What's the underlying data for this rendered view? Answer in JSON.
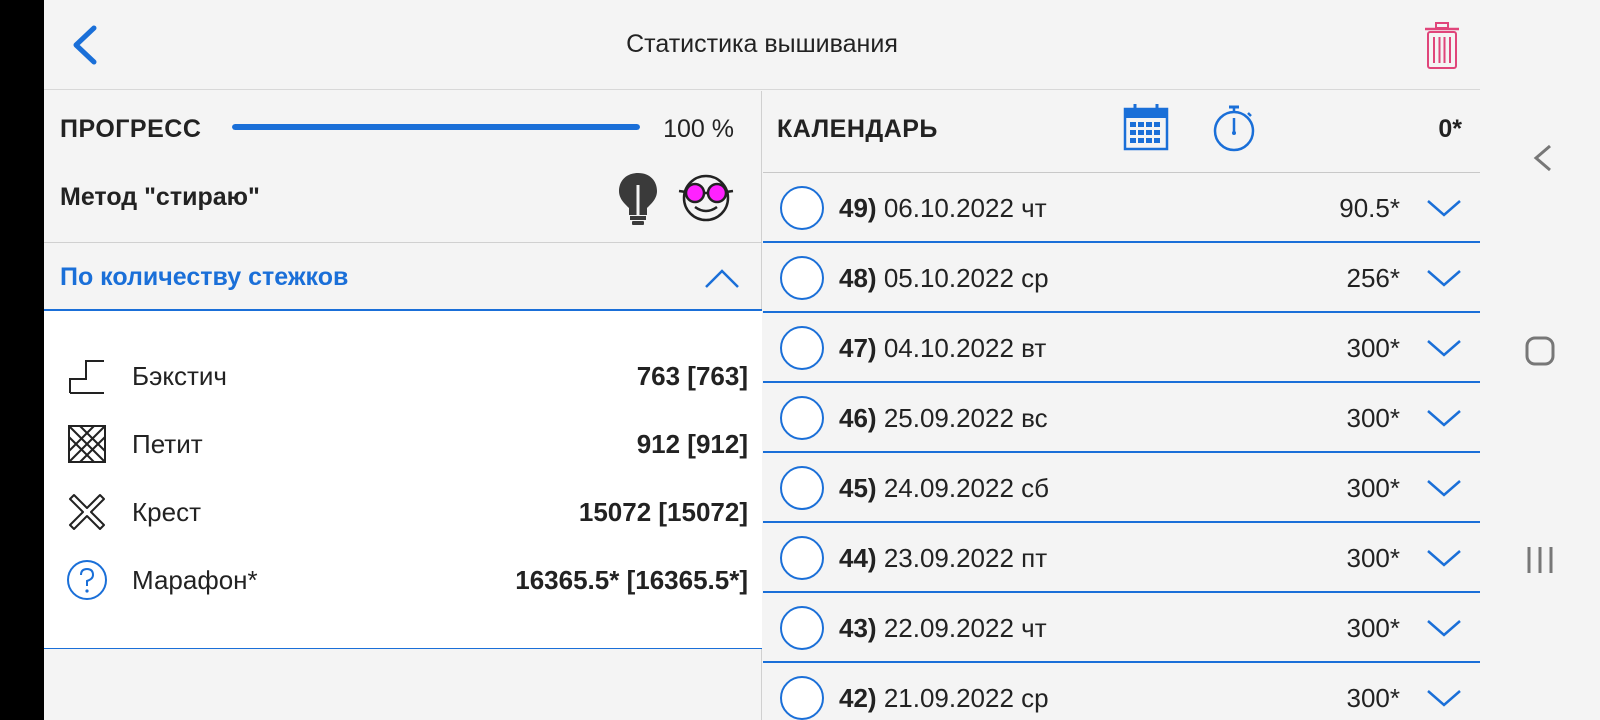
{
  "header": {
    "title": "Статистика вышивания",
    "back_icon": "chevron-left-icon",
    "trash_icon": "trash-icon"
  },
  "progress": {
    "label": "ПРОГРЕСС",
    "percent": 100,
    "value_text": "100 %"
  },
  "method": {
    "label": "Метод \"стираю\"",
    "icons": [
      "lightbulb-icon",
      "glasses-face-icon"
    ]
  },
  "stitch_section": {
    "title": "По количеству стежков",
    "expanded": true,
    "rows": [
      {
        "icon": "backstitch-icon",
        "name": "Бэкстич",
        "value": "763 [763]"
      },
      {
        "icon": "petit-icon",
        "name": "Петит",
        "value": "912 [912]"
      },
      {
        "icon": "cross-stitch-icon",
        "name": "Крест",
        "value": "15072 [15072]"
      },
      {
        "icon": "question-icon",
        "name": "Марафон*",
        "value": "16365.5* [16365.5*]"
      }
    ]
  },
  "calendar": {
    "title": "КАЛЕНДАРЬ",
    "total": "0*",
    "icons": [
      "calendar-icon",
      "stopwatch-icon"
    ],
    "days": [
      {
        "num": "49)",
        "date": "06.10.2022 чт",
        "value": "90.5*"
      },
      {
        "num": "48)",
        "date": "05.10.2022 ср",
        "value": "256*"
      },
      {
        "num": "47)",
        "date": "04.10.2022 вт",
        "value": "300*"
      },
      {
        "num": "46)",
        "date": "25.09.2022 вс",
        "value": "300*"
      },
      {
        "num": "45)",
        "date": "24.09.2022 сб",
        "value": "300*"
      },
      {
        "num": "44)",
        "date": "23.09.2022 пт",
        "value": "300*"
      },
      {
        "num": "43)",
        "date": "22.09.2022 чт",
        "value": "300*"
      },
      {
        "num": "42)",
        "date": "21.09.2022 ср",
        "value": "300*"
      }
    ]
  },
  "colors": {
    "accent": "#1a6fd8",
    "trash": "#e0457a",
    "glasses": "#ff22ff",
    "background": "#f4f4f4"
  },
  "system_nav": [
    "nav-back-icon",
    "nav-home-icon",
    "nav-recents-icon"
  ]
}
